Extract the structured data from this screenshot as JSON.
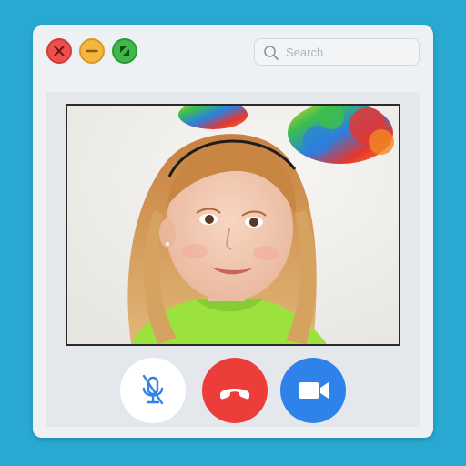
{
  "window": {
    "controls": {
      "close_icon": "close-icon",
      "minimize_icon": "minimize-icon",
      "maximize_icon": "maximize-icon"
    },
    "search": {
      "placeholder": "Search",
      "icon": "search-icon"
    }
  },
  "call": {
    "video_feed": "remote-participant-video",
    "controls": {
      "mute_icon": "microphone-muted-icon",
      "end_icon": "phone-hangup-icon",
      "camera_icon": "video-camera-icon"
    }
  },
  "colors": {
    "background": "#29a9d1",
    "close": "#ed4f4d",
    "minimize": "#f4b63f",
    "maximize": "#3fba4a",
    "end_call": "#ec3d3a",
    "camera": "#2f82ea",
    "mic_muted": "#2f82ea"
  }
}
